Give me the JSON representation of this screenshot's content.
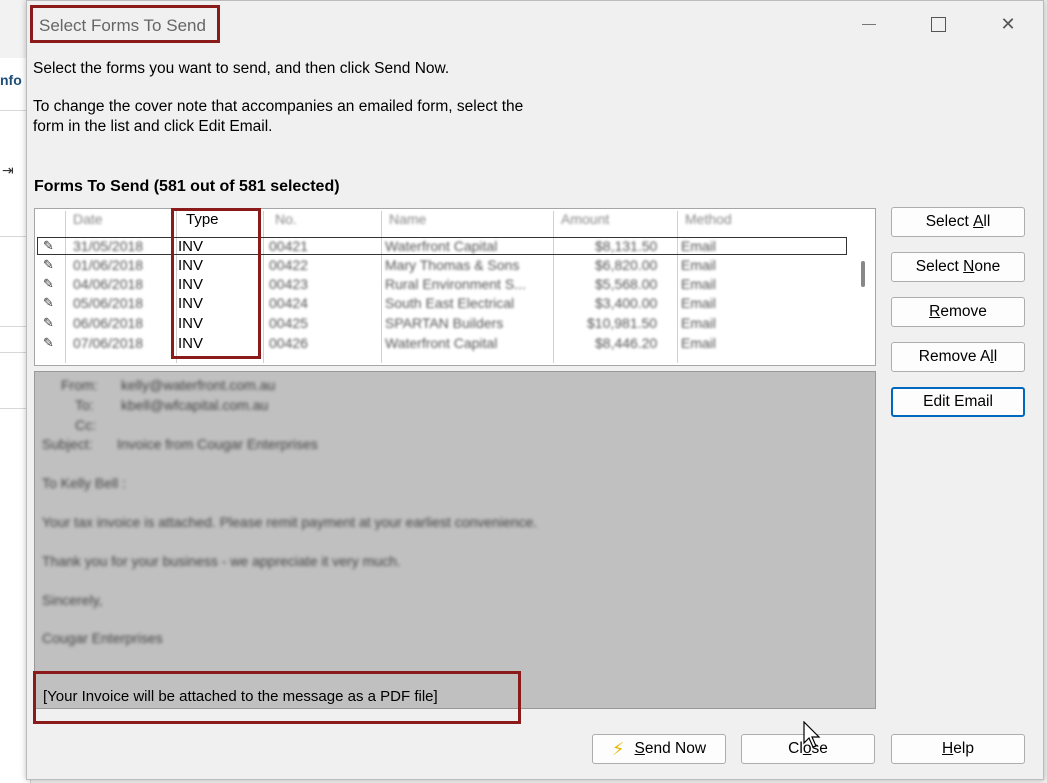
{
  "background": {
    "partial_text": "nfo"
  },
  "window": {
    "title": "Select Forms To Send"
  },
  "instructions": {
    "line1": "Select the forms you want to send, and then click Send Now.",
    "line2": "To change the cover note that accompanies an emailed form, select the form in the list and click Edit Email."
  },
  "list": {
    "title": "Forms To Send (581 out of 581 selected)",
    "columns": [
      "Date",
      "Type",
      "No.",
      "Name",
      "Amount",
      "Method"
    ],
    "rows": [
      {
        "date": "31/05/2018",
        "type": "INV",
        "no": "00421",
        "name": "Waterfront Capital",
        "amount": "$8,131.50",
        "method": "Email"
      },
      {
        "date": "01/06/2018",
        "type": "INV",
        "no": "00422",
        "name": "Mary Thomas & Sons",
        "amount": "$6,820.00",
        "method": "Email"
      },
      {
        "date": "04/06/2018",
        "type": "INV",
        "no": "00423",
        "name": "Rural Environment S...",
        "amount": "$5,568.00",
        "method": "Email"
      },
      {
        "date": "05/06/2018",
        "type": "INV",
        "no": "00424",
        "name": "South East Electrical",
        "amount": "$3,400.00",
        "method": "Email"
      },
      {
        "date": "06/06/2018",
        "type": "INV",
        "no": "00425",
        "name": "SPARTAN Builders",
        "amount": "$10,981.50",
        "method": "Email"
      },
      {
        "date": "07/06/2018",
        "type": "INV",
        "no": "00426",
        "name": "Waterfront Capital",
        "amount": "$8,446.20",
        "method": "Email"
      }
    ]
  },
  "preview": {
    "from_label": "From:",
    "from_value": "kelly@waterfront.com.au",
    "to_label": "To:",
    "to_value": "kbell@wfcapital.com.au",
    "cc_label": "Cc:",
    "subject_label": "Subject:",
    "subject_value": "Invoice from Cougar Enterprises",
    "greeting": "To Kelly Bell :",
    "body1": "Your tax invoice is attached. Please remit payment at your earliest convenience.",
    "body2": "Thank you for your business - we appreciate it very much.",
    "closing": "Sincerely,",
    "signature": "Cougar Enterprises",
    "attachment_note": "[Your Invoice will be attached to the message as a PDF file]"
  },
  "buttons": {
    "select_all": {
      "pre": "Select ",
      "u": "A",
      "post": "ll"
    },
    "select_none": {
      "pre": "Select ",
      "u": "N",
      "post": "one"
    },
    "remove": {
      "pre": "",
      "u": "R",
      "post": "emove"
    },
    "remove_all": {
      "pre": "Remove A",
      "u": "l",
      "post": "l"
    },
    "edit_email": {
      "label": "Edit Email"
    },
    "send_now": {
      "pre": "",
      "u": "S",
      "post": "end Now"
    },
    "close": {
      "pre": "Cl",
      "u": "o",
      "post": "se"
    },
    "help": {
      "pre": "",
      "u": "H",
      "post": "elp"
    }
  }
}
